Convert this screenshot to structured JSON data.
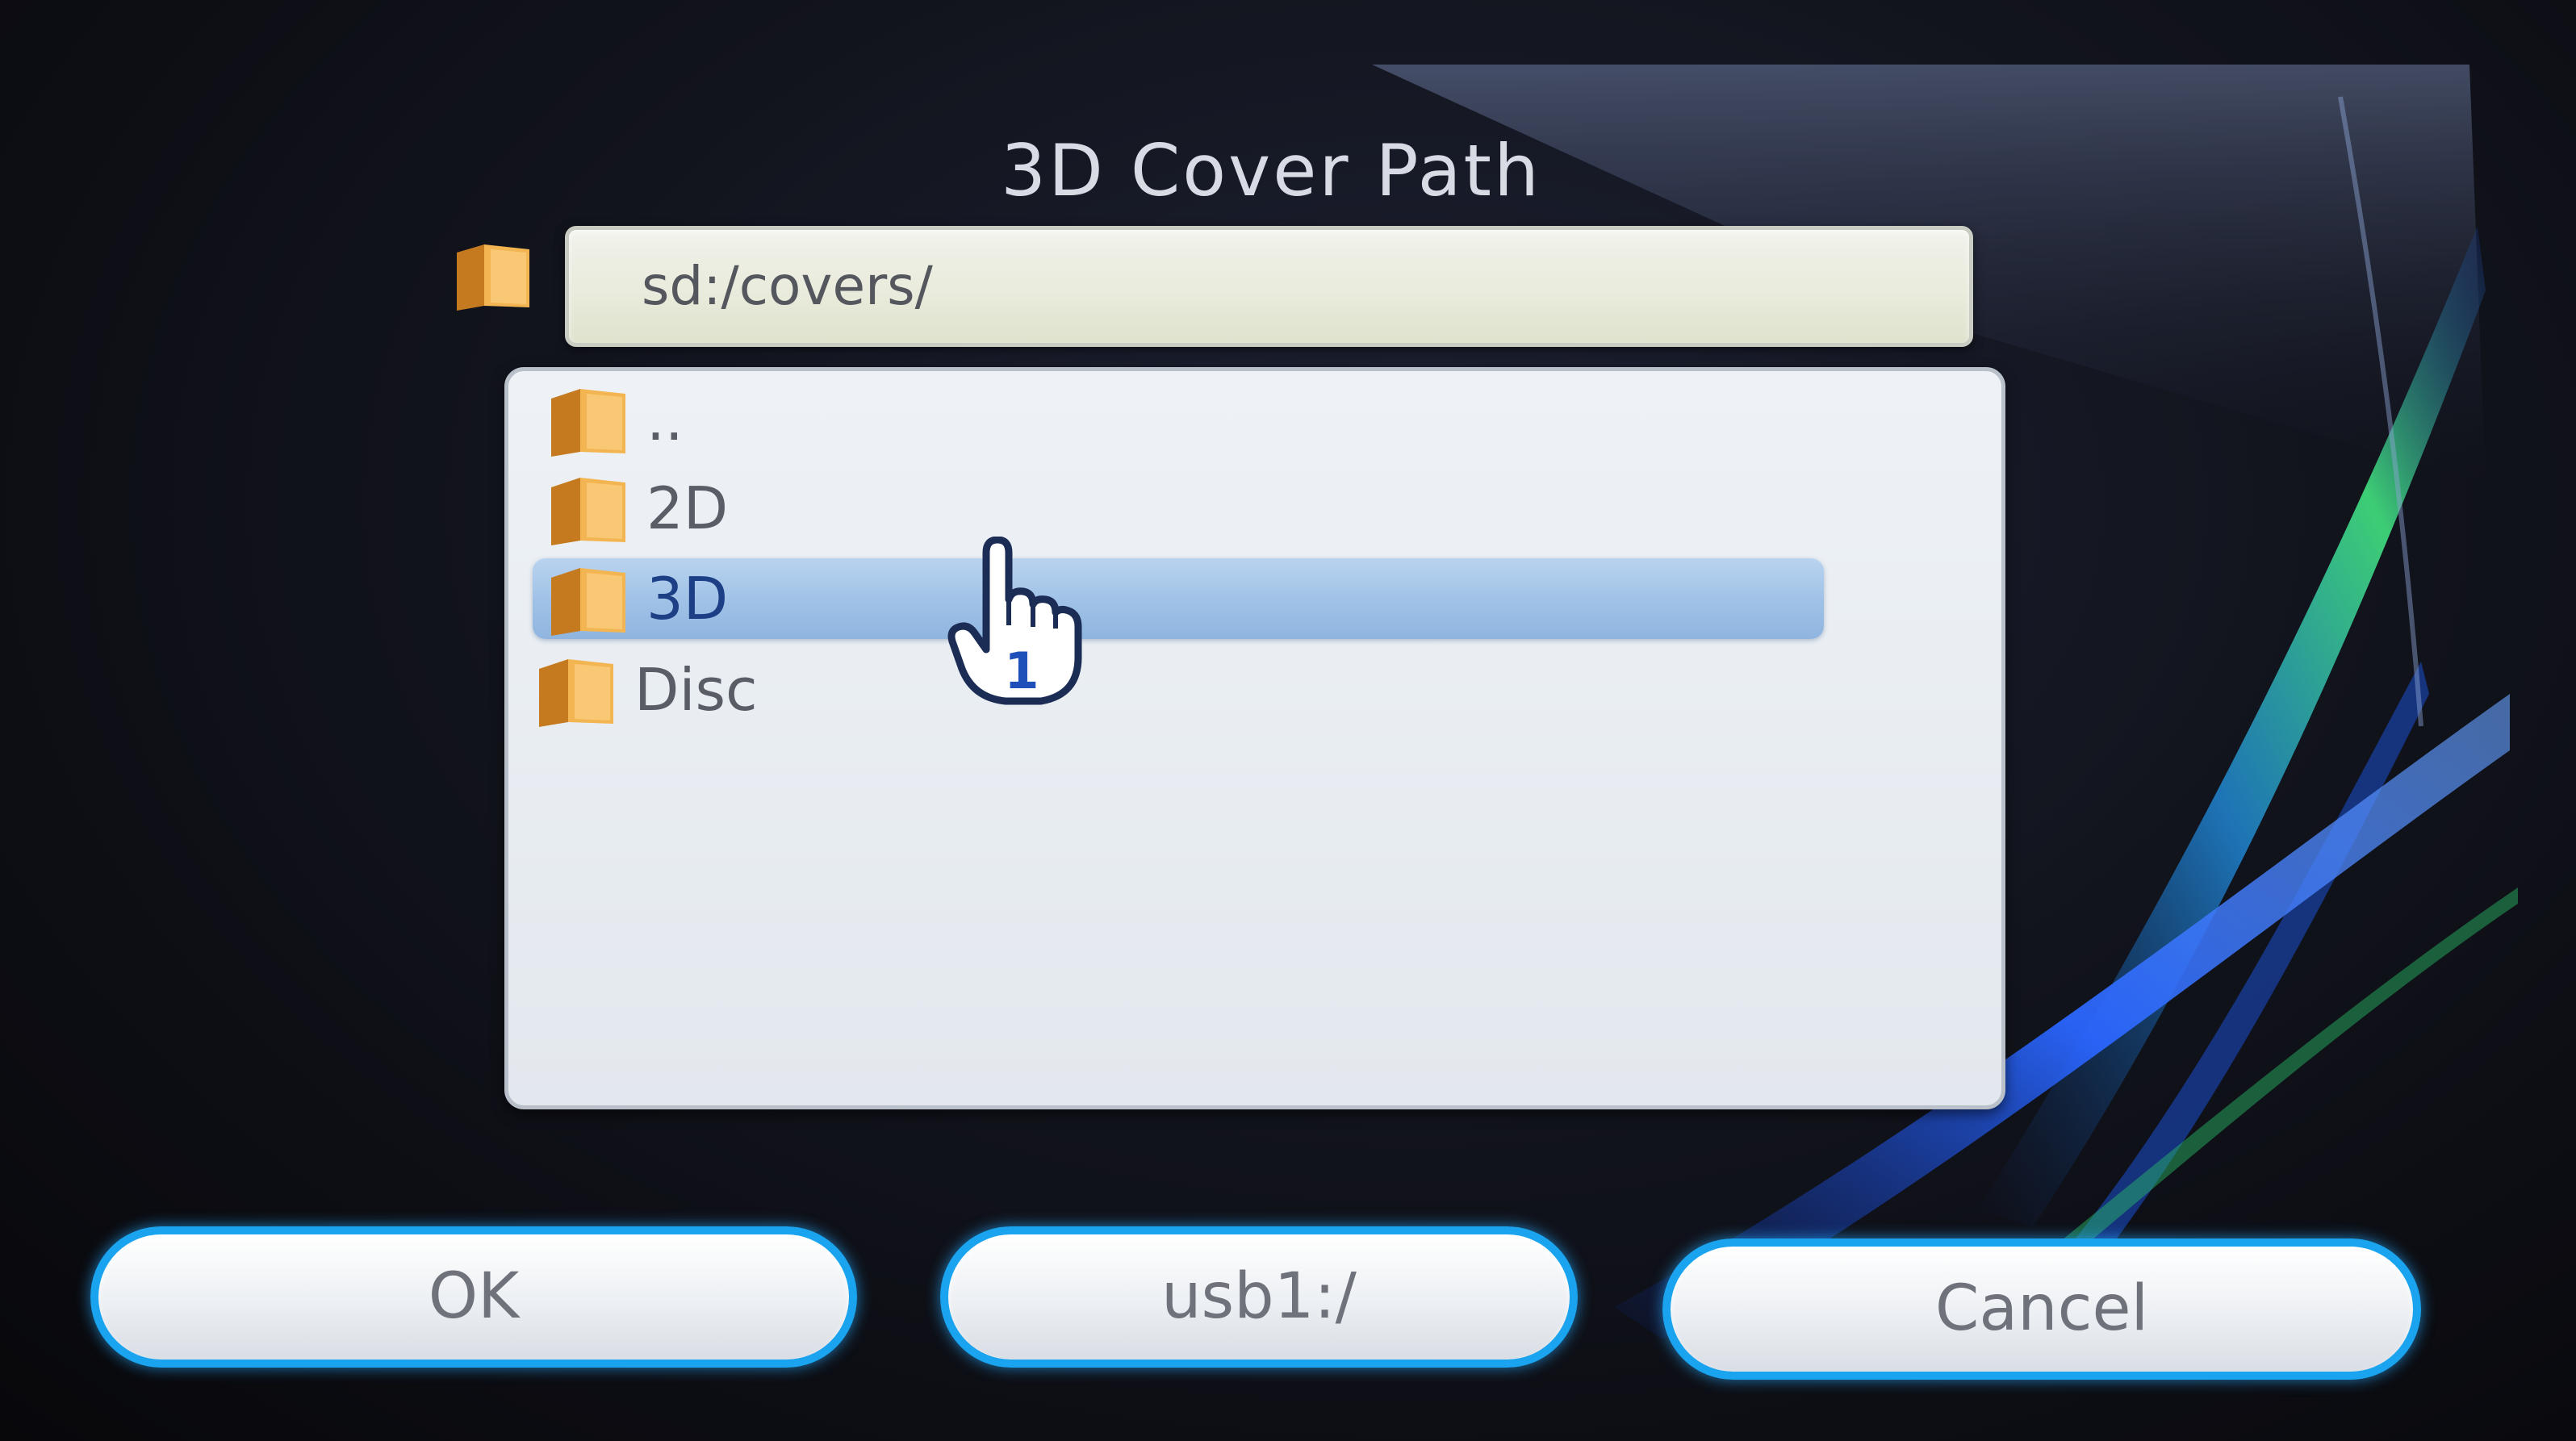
{
  "dialog": {
    "title": "3D Cover Path",
    "current_path": "sd:/covers/"
  },
  "file_list": {
    "items": [
      {
        "label": "..",
        "icon": "folder-icon",
        "selected": false
      },
      {
        "label": "2D",
        "icon": "folder-icon",
        "selected": false
      },
      {
        "label": "3D",
        "icon": "folder-icon",
        "selected": true
      },
      {
        "label": "Disc",
        "icon": "folder-icon",
        "selected": false
      }
    ]
  },
  "cursor": {
    "player_number": "1",
    "icon": "hand-pointer-icon"
  },
  "buttons": {
    "ok_label": "OK",
    "device_label": "usb1:/",
    "cancel_label": "Cancel"
  },
  "colors": {
    "button_border": "#1aa3ee",
    "selection": "#9fc1e6",
    "folder": "#e6a23c"
  }
}
